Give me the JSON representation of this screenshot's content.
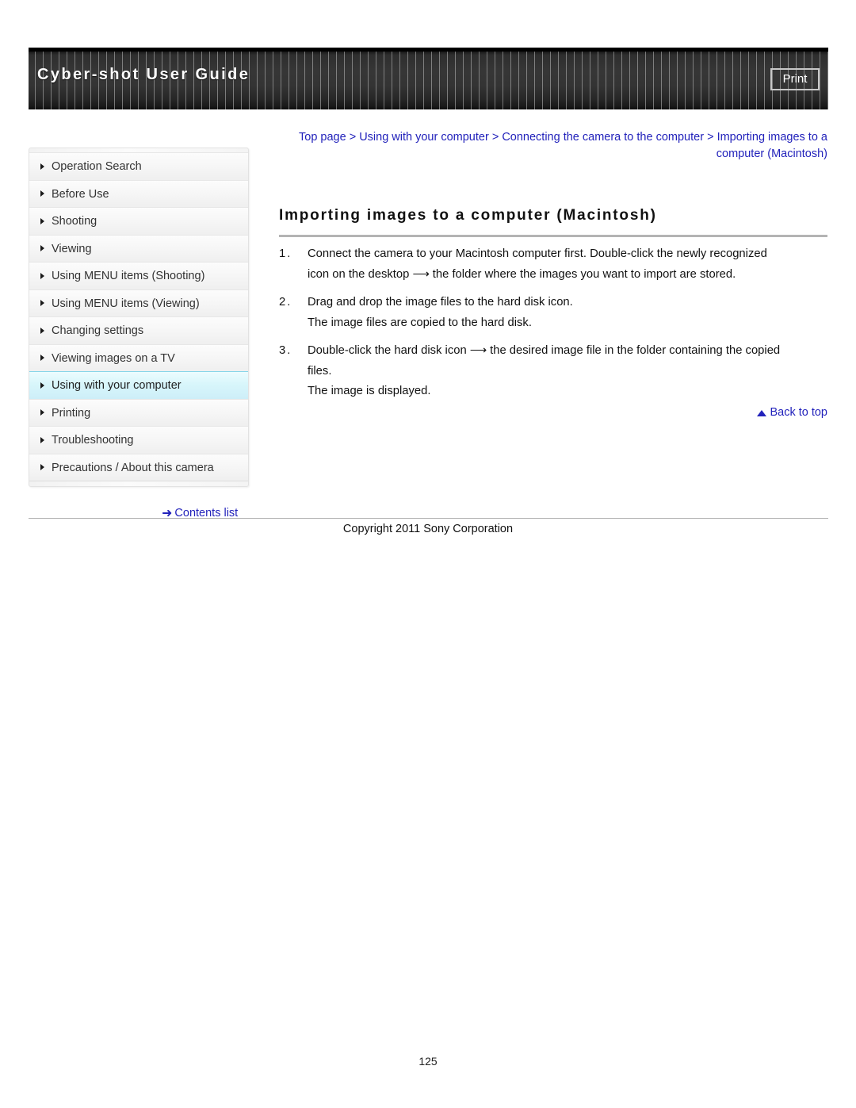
{
  "header": {
    "title": "Cyber-shot User Guide",
    "print_label": "Print"
  },
  "breadcrumb": {
    "items": [
      "Top page",
      "Using with your computer",
      "Connecting the camera to the computer",
      "Importing images to a computer (Macintosh)"
    ],
    "separator": ">",
    "full_text": "Top page > Using with your computer > Connecting the camera to the computer > Importing images to a computer (Macintosh)",
    "color": "#2222bb"
  },
  "sidebar": {
    "items": [
      {
        "label": "Operation Search",
        "active": false
      },
      {
        "label": "Before Use",
        "active": false
      },
      {
        "label": "Shooting",
        "active": false
      },
      {
        "label": "Viewing",
        "active": false
      },
      {
        "label": "Using MENU items (Shooting)",
        "active": false
      },
      {
        "label": "Using MENU items (Viewing)",
        "active": false
      },
      {
        "label": "Changing settings",
        "active": false
      },
      {
        "label": "Viewing images on a TV",
        "active": false
      },
      {
        "label": "Using with your computer",
        "active": true
      },
      {
        "label": "Printing",
        "active": false
      },
      {
        "label": "Troubleshooting",
        "active": false
      },
      {
        "label": "Precautions / About this camera",
        "active": false
      }
    ],
    "active_highlight_color": "#d8f6fb",
    "contents_list_label": "Contents list",
    "contents_list_arrow": "➜"
  },
  "main": {
    "heading": "Importing images to a computer (Macintosh)",
    "steps": [
      {
        "number": "1.",
        "lines": [
          "Connect the camera to your Macintosh computer first. Double-click the newly recognized",
          "icon on the desktop ⟶ the folder where the images you want to import are stored."
        ]
      },
      {
        "number": "2.",
        "lines": [
          "Drag and drop the image files to the hard disk icon.",
          "The image files are copied to the hard disk."
        ]
      },
      {
        "number": "3.",
        "lines": [
          "Double-click the hard disk icon ⟶ the desired image file in the folder containing the copied",
          "files.",
          "The image is displayed."
        ]
      }
    ],
    "back_to_top_label": "Back to top"
  },
  "footer": {
    "copyright": "Copyright 2011 Sony Corporation",
    "page_number": "125"
  }
}
